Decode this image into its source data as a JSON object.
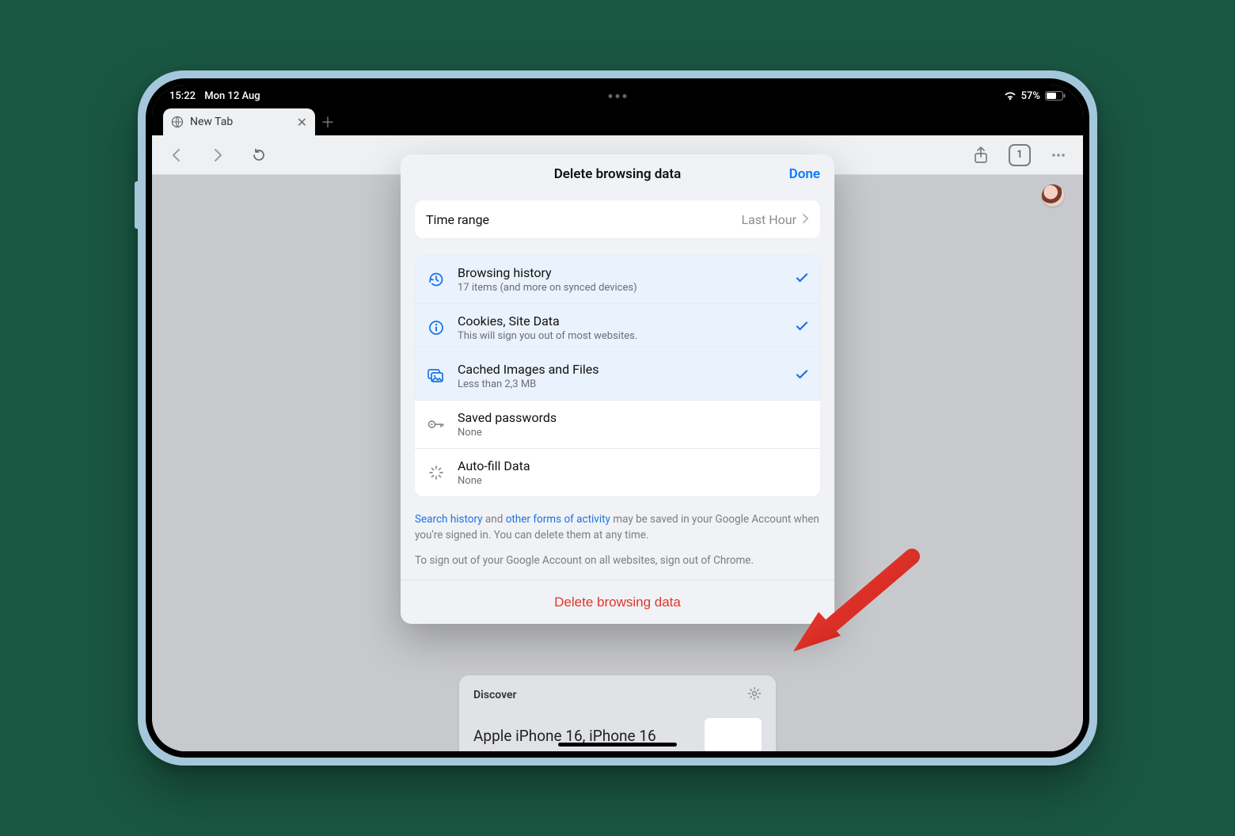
{
  "statusbar": {
    "time": "15:22",
    "date": "Mon 12 Aug",
    "battery_pct": "57%"
  },
  "tab": {
    "title": "New Tab"
  },
  "toolbar": {
    "tab_count": "1"
  },
  "discover": {
    "heading": "Discover",
    "article_title": "Apple iPhone 16, iPhone 16"
  },
  "sheet": {
    "title": "Delete browsing data",
    "done": "Done",
    "time_range_label": "Time range",
    "time_range_value": "Last Hour",
    "items": [
      {
        "title": "Browsing history",
        "sub": "17 items (and more on synced devices)"
      },
      {
        "title": "Cookies, Site Data",
        "sub": "This will sign you out of most websites."
      },
      {
        "title": "Cached Images and Files",
        "sub": "Less than 2,3 MB"
      },
      {
        "title": "Saved passwords",
        "sub": "None"
      },
      {
        "title": "Auto-fill Data",
        "sub": "None"
      }
    ],
    "footnote_link1": "Search history",
    "footnote_mid1": " and ",
    "footnote_link2": "other forms of activity",
    "footnote_tail": " may be saved in your Google Account when you're signed in. You can delete them at any time.",
    "footnote2_lead": "To sign out of your Google Account on all websites, ",
    "footnote2_link": "sign out of Chrome",
    "footnote2_tail": ".",
    "delete_btn": "Delete browsing data"
  }
}
